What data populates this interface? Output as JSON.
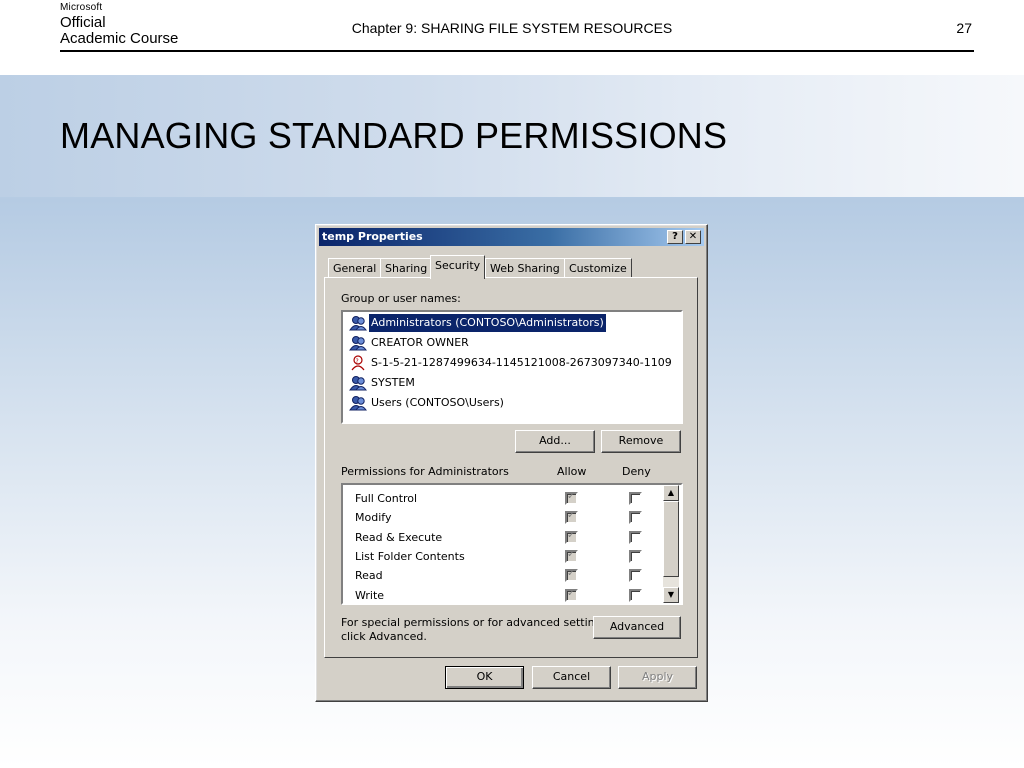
{
  "slide": {
    "logo": {
      "line1": "Microsoft",
      "line2": "Official",
      "line3": "Academic Course"
    },
    "chapter": "Chapter 9: SHARING FILE SYSTEM RESOURCES",
    "page_number": "27",
    "title": "MANAGING STANDARD PERMISSIONS"
  },
  "dialog": {
    "title": "temp Properties",
    "help_label": "?",
    "close_label": "✕",
    "tabs": [
      {
        "label": "General"
      },
      {
        "label": "Sharing"
      },
      {
        "label": "Security"
      },
      {
        "label": "Web Sharing"
      },
      {
        "label": "Customize"
      }
    ],
    "active_tab": "Security",
    "groups_label": "Group or user names:",
    "groups": [
      {
        "name": "Administrators (CONTOSO\\Administrators)",
        "icon": "group-icon",
        "selected": true
      },
      {
        "name": "CREATOR OWNER",
        "icon": "group-icon"
      },
      {
        "name": "S-1-5-21-1287499634-1145121008-2673097340-1109",
        "icon": "unknown-user-icon"
      },
      {
        "name": "SYSTEM",
        "icon": "group-icon"
      },
      {
        "name": "Users (CONTOSO\\Users)",
        "icon": "group-icon"
      }
    ],
    "add_button": "Add...",
    "remove_button": "Remove",
    "permissions_label": "Permissions for Administrators",
    "allow_header": "Allow",
    "deny_header": "Deny",
    "permissions": [
      {
        "name": "Full Control",
        "allow": true,
        "deny": false
      },
      {
        "name": "Modify",
        "allow": true,
        "deny": false
      },
      {
        "name": "Read & Execute",
        "allow": true,
        "deny": false
      },
      {
        "name": "List Folder Contents",
        "allow": true,
        "deny": false
      },
      {
        "name": "Read",
        "allow": true,
        "deny": false
      },
      {
        "name": "Write",
        "allow": true,
        "deny": false
      }
    ],
    "advanced_text_line1": "For special permissions or for advanced settings,",
    "advanced_text_line2": "click Advanced.",
    "advanced_button": "Advanced",
    "ok_button": "OK",
    "cancel_button": "Cancel",
    "apply_button": "Apply"
  }
}
